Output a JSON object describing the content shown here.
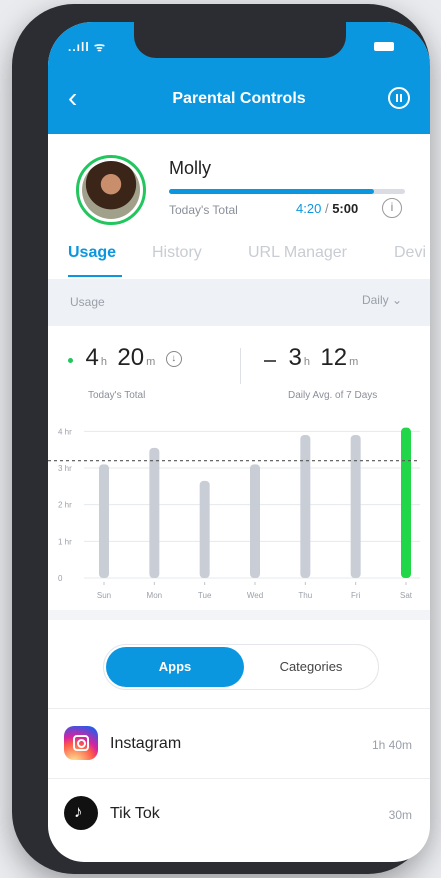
{
  "status": {
    "signal": "..ıll ᯤ"
  },
  "header": {
    "title": "Parental Controls",
    "back_icon": "chevron-left-icon",
    "pause_icon": "pause-circle-icon"
  },
  "profile": {
    "name": "Molly",
    "today_label": "Today's Total",
    "used": "4:20",
    "separator": "/",
    "limit": "5:00",
    "progress_fraction": 0.87,
    "info_glyph": "i"
  },
  "tabs": [
    {
      "label": "Usage",
      "active": true
    },
    {
      "label": "History",
      "active": false
    },
    {
      "label": "URL Manager",
      "active": false
    },
    {
      "label": "Devi",
      "active": false
    }
  ],
  "section": {
    "label": "Usage",
    "period": "Daily ⌄"
  },
  "stats": {
    "today": {
      "hours": "4",
      "hours_unit": "h",
      "minutes": "20",
      "minutes_unit": "m",
      "label": "Today's Total"
    },
    "avg": {
      "hours": "3",
      "hours_unit": "h",
      "minutes": "12",
      "minutes_unit": "m",
      "label": "Daily Avg. of 7 Days"
    }
  },
  "chart_data": {
    "type": "bar",
    "categories": [
      "Sun",
      "Mon",
      "Tue",
      "Wed",
      "Thu",
      "Fri",
      "Sat"
    ],
    "values": [
      3.1,
      3.55,
      2.65,
      3.1,
      3.9,
      3.9,
      4.1
    ],
    "y_ticks": [
      {
        "value": 0,
        "label": "0"
      },
      {
        "value": 1,
        "label": "1 hr"
      },
      {
        "value": 2,
        "label": "2 hr"
      },
      {
        "value": 3,
        "label": "3 hr"
      },
      {
        "value": 4,
        "label": "4 hr"
      }
    ],
    "ylim": [
      0,
      4.2
    ],
    "average_line": 3.2,
    "colors": {
      "bar": "#c9ced6",
      "highlight": "#22d64a",
      "avg": "#555555",
      "grid": "#e6e9ed"
    },
    "highlight_index": 6
  },
  "toggle": {
    "apps_label": "Apps",
    "categories_label": "Categories"
  },
  "apps": [
    {
      "name": "Instagram",
      "time": "1h 40m",
      "icon": "instagram-icon"
    },
    {
      "name": "Tik Tok",
      "time": "30m",
      "icon": "tiktok-icon"
    }
  ]
}
